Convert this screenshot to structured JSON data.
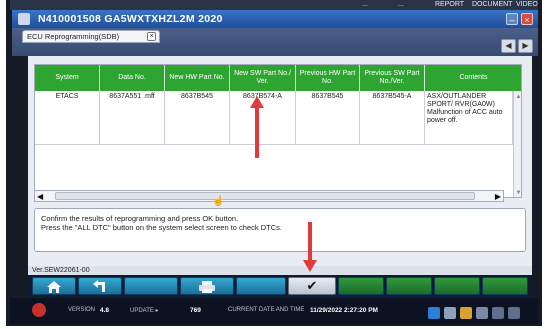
{
  "system_menu": {
    "items": [
      "...",
      "...",
      "REPORT",
      "DOCUMENT",
      "VIDEO"
    ]
  },
  "window": {
    "title": "N410001508   GA5WXTXHZL2M 2020",
    "minimize_glyph": "–",
    "close_glyph": "×",
    "accent_color": "#1e4f9a"
  },
  "tabs": [
    {
      "label": "ECU Reprogramming(SDB)",
      "close_glyph": "×"
    }
  ],
  "nav": {
    "back_glyph": "◀",
    "forward_glyph": "▶"
  },
  "table": {
    "header_color": "#2fa531",
    "columns": [
      "System",
      "Data No.",
      "New HW Part No.",
      "New SW Part No./ Ver.",
      "Previous HW Part No.",
      "Previous SW Part No./Ver.",
      "Contents"
    ],
    "rows": [
      {
        "system": "ETACS",
        "data_no": "8637A551 .mff",
        "new_hw": "8637B545",
        "new_sw": "8637B574-A",
        "prev_hw": "8637B545",
        "prev_sw": "8637B545-A",
        "contents": "ASX/OUTLANDER SPORT/ RVR(GA0W)    Malfunction of ACC auto power off."
      }
    ]
  },
  "message": {
    "line1": "Confirm the results of reprogramming and press OK button.",
    "line2": "Press the \"ALL DTC\" button on the system select screen to check DTCs."
  },
  "version": "Ver.SEW22061-00",
  "toolbar": {
    "ok_glyph": "✔"
  },
  "taskbar": {
    "version_label": "VERSION",
    "version_value": "4.8",
    "update_label": "UPDATE ▸",
    "update_value": "769",
    "datetime_label": "CURRENT DATE AND TIME",
    "datetime_value": "11/29/2022 2:27:20 PM"
  },
  "annotations": {
    "arrow_color": "#e03a3a"
  }
}
